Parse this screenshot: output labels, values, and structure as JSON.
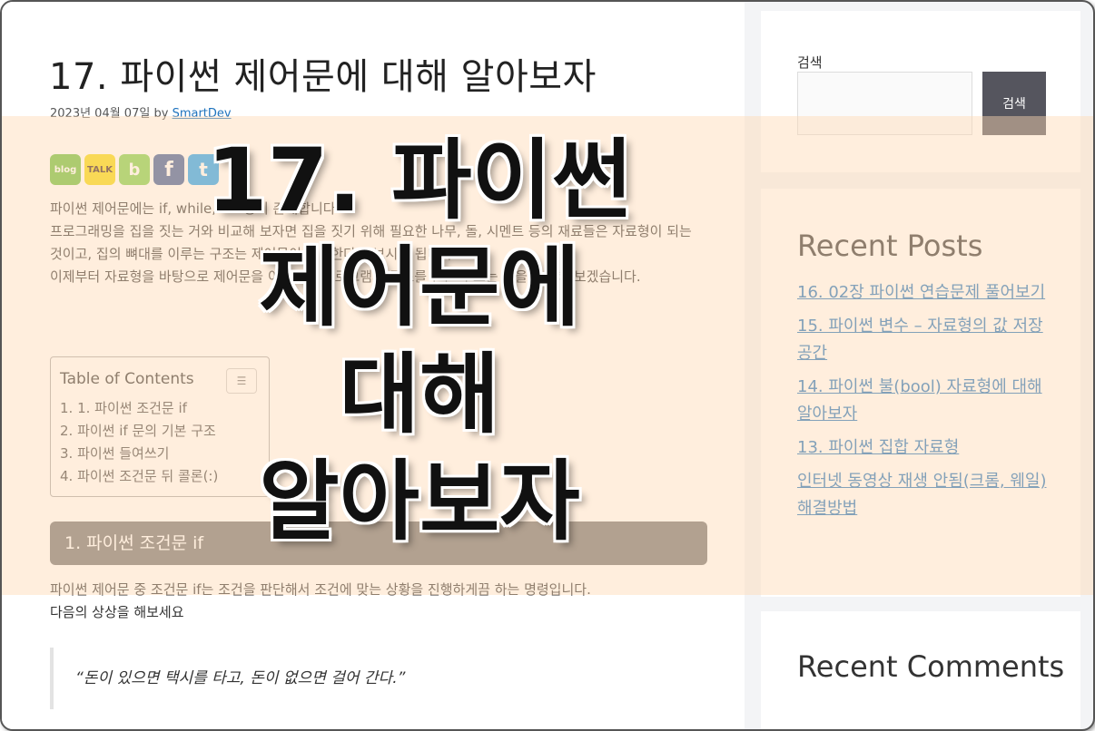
{
  "post": {
    "title": "17. 파이썬 제어문에 대해 알아보자",
    "date": "2023년 04월 07일",
    "by": "by",
    "author": "SmartDev"
  },
  "share": [
    {
      "name": "blog",
      "label": "blog",
      "color": "#6bbf3a"
    },
    {
      "name": "kakaotalk",
      "label": "TALK",
      "color": "#f5d90a"
    },
    {
      "name": "band",
      "label": "b",
      "color": "#7fcf4a"
    },
    {
      "name": "facebook",
      "label": "f",
      "color": "#3b5998"
    },
    {
      "name": "twitter",
      "label": "t",
      "color": "#1da1f2"
    }
  ],
  "intro": [
    "파이썬 제어문에는 if, while, for 등이 존재합니다.",
    "프로그래밍을 집을 짓는 거와 비교해 보자면 집을 짓기 위해 필요한 나무, 돌, 시멘트 등의 재료들은 자료형이 되는 것이고, 집의 뼈대를 이루는 구조는 제어문이 담당한다고 보시면 됩니다.",
    "이제부터 자료형을 바탕으로 제어문을 이용하여 프로그램의 구조를 만들어 보는 것을 공부해 보겠습니다."
  ],
  "toc": {
    "title": "Table of Contents",
    "items": [
      "1. 1. 파이썬 조건문 if",
      "2. 파이썬 if 문의 기본 구조",
      "3. 파이썬 들여쓰기",
      "4. 파이썬 조건문 뒤 콜론(:)"
    ]
  },
  "section": {
    "heading": "1. 파이썬 조건문 if",
    "text": [
      "파이썬 제어문 중 조건문 if는 조건을 판단해서 조건에 맞는 상황을 진행하게끔 하는 명령입니다.",
      "다음의 상상을 해보세요"
    ],
    "quote": "“돈이 있으면 택시를 타고, 돈이 없으면 걸어 간다.”"
  },
  "sidebar": {
    "search_label": "검색",
    "search_button": "검색",
    "recent_posts_title": "Recent Posts",
    "recent_posts": [
      "16. 02장 파이썬 연습문제 풀어보기",
      "15. 파이썬 변수 – 자료형의 값 저장공간",
      "14. 파이썬 불(bool) 자료형에 대해 알아보자",
      "13. 파이썬 집합 자료형",
      "인터넷 동영상 재생 안됨(크롬, 웨일) 해결방법"
    ],
    "recent_comments_title": "Recent Comments"
  },
  "overlay_title": [
    "17. 파이썬",
    "제어문에",
    "대해",
    "알아보자"
  ]
}
